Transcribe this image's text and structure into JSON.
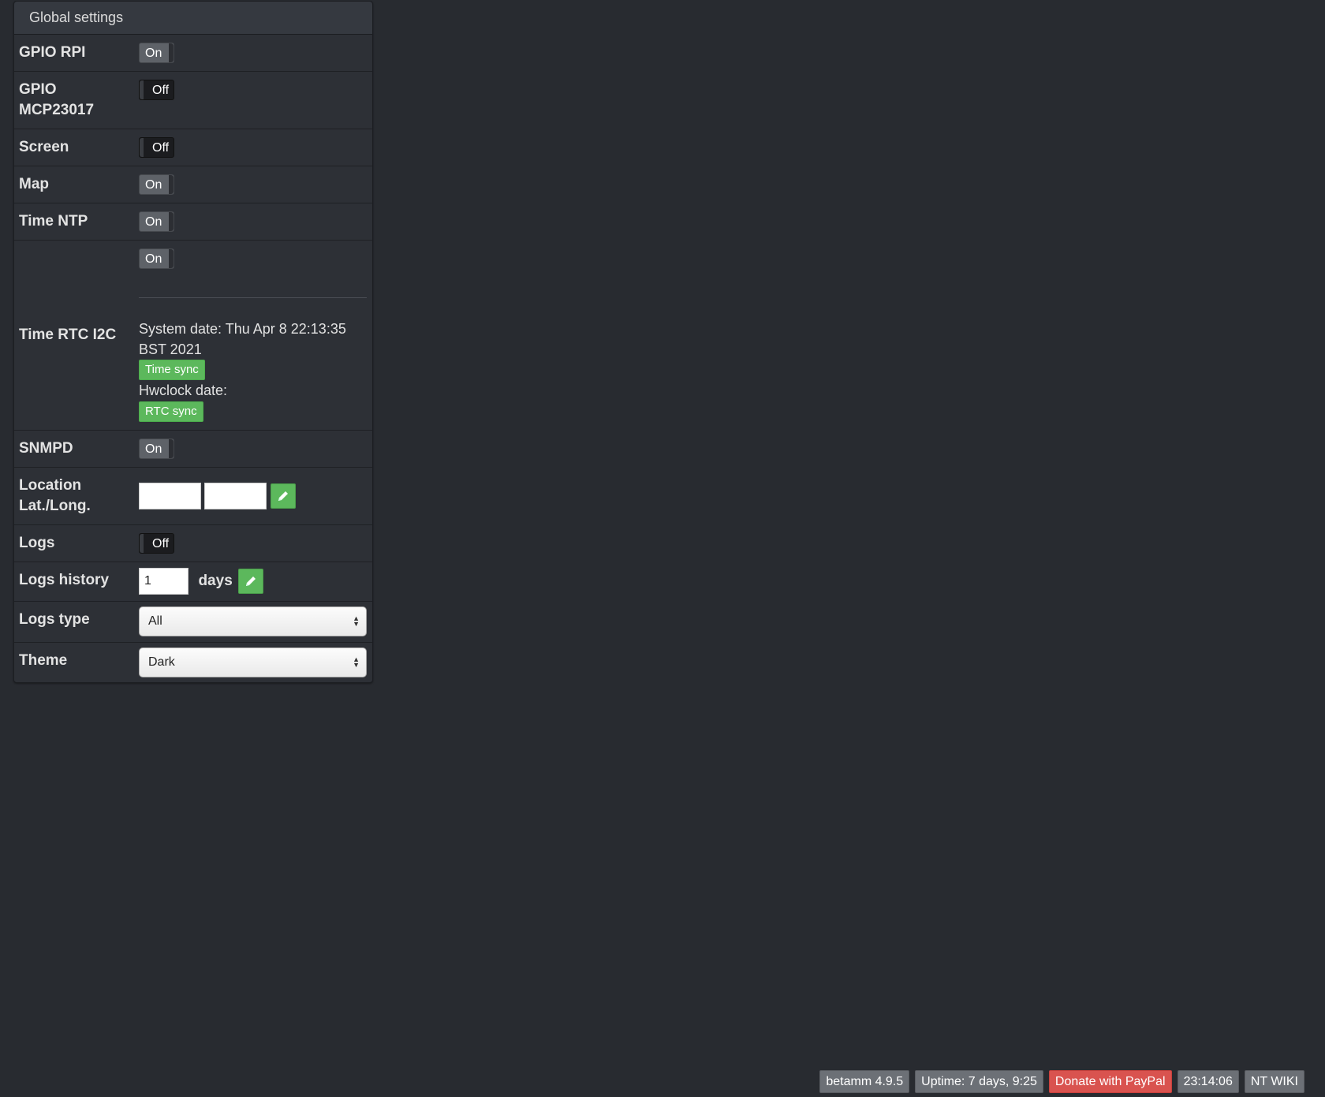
{
  "panel": {
    "title": "Global settings"
  },
  "rows": {
    "gpio_rpi": {
      "label": "GPIO RPI",
      "toggle": "On"
    },
    "gpio_mcp": {
      "label_line1": "GPIO",
      "label_line2": "MCP23017",
      "toggle": "Off"
    },
    "screen": {
      "label": "Screen",
      "toggle": "Off"
    },
    "map": {
      "label": "Map",
      "toggle": "On"
    },
    "time_ntp": {
      "label": "Time NTP",
      "toggle": "On"
    },
    "time_rtc": {
      "label": "Time RTC I2C",
      "toggle": "On",
      "system_date": "System date: Thu Apr 8 22:13:35 BST 2021",
      "time_sync_button": "Time sync",
      "hwclock_date": "Hwclock date:",
      "rtc_sync_button": "RTC sync"
    },
    "snmpd": {
      "label": "SNMPD",
      "toggle": "On"
    },
    "location": {
      "label_line1": "Location",
      "label_line2": "Lat./Long.",
      "lat_value": "",
      "long_value": ""
    },
    "logs": {
      "label": "Logs",
      "toggle": "Off"
    },
    "logs_history": {
      "label": "Logs history",
      "value": "1",
      "unit": "days"
    },
    "logs_type": {
      "label": "Logs type",
      "selected": "All"
    },
    "theme": {
      "label": "Theme",
      "selected": "Dark"
    }
  },
  "footer": {
    "version": "betamm 4.9.5",
    "uptime": "Uptime: 7 days, 9:25",
    "donate": "Donate with PayPal",
    "clock": "23:14:06",
    "wiki": "NT WIKI"
  },
  "colors": {
    "background": "#282b30",
    "success": "#5cb85c",
    "danger": "#d9534f"
  }
}
